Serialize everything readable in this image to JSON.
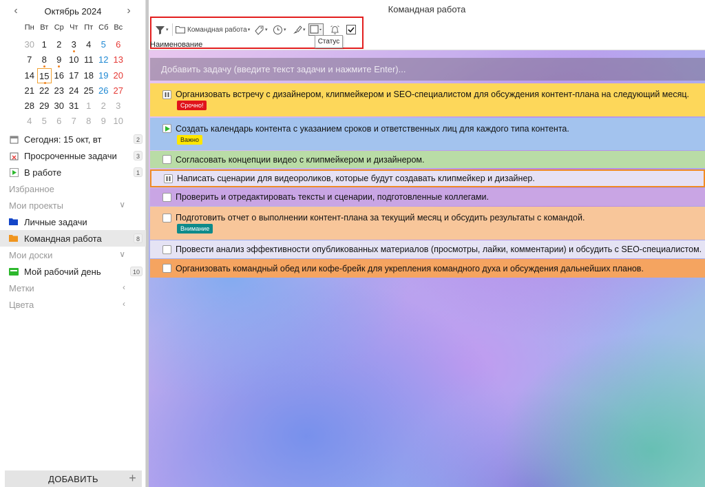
{
  "calendar": {
    "title": "Октябрь 2024",
    "prev": "‹",
    "next": "›",
    "weekdays": [
      "Пн",
      "Вт",
      "Ср",
      "Чт",
      "Пт",
      "Сб",
      "Вс"
    ],
    "weeks": [
      [
        "30",
        "1",
        "2",
        "3",
        "4",
        "5",
        "6"
      ],
      [
        "7",
        "8",
        "9",
        "10",
        "11",
        "12",
        "13"
      ],
      [
        "14",
        "15",
        "16",
        "17",
        "18",
        "19",
        "20"
      ],
      [
        "21",
        "22",
        "23",
        "24",
        "25",
        "26",
        "27"
      ],
      [
        "28",
        "29",
        "30",
        "31",
        "1",
        "2",
        "3"
      ],
      [
        "4",
        "5",
        "6",
        "7",
        "8",
        "9",
        "10"
      ]
    ],
    "today": "15"
  },
  "nav": {
    "today": {
      "label": "Сегодня: 15 окт, вт",
      "count": "2"
    },
    "overdue": {
      "label": "Просроченные задачи",
      "count": "3"
    },
    "in_progress": {
      "label": "В работе",
      "count": "1"
    },
    "favorites": "Избранное",
    "my_projects": "Мои проекты",
    "personal": "Личные задачи",
    "team": {
      "label": "Командная работа",
      "count": "8"
    },
    "my_boards": "Мои доски",
    "workday": {
      "label": "Мой рабочий день",
      "count": "10"
    },
    "tags": "Метки",
    "colors": "Цвета"
  },
  "add_button": "ДОБАВИТЬ",
  "add_plus": "+",
  "main": {
    "title": "Командная работа",
    "toolbar": {
      "project": "Командная работа",
      "tooltip": "Статус"
    },
    "column_header": "Наименование",
    "add_task_placeholder": "Добавить задачу (введите текст задачи и нажмите Enter)..."
  },
  "tasks": [
    {
      "text": "Организовать встречу с дизайнером, клипмейкером и SEO-специалистом для обсуждения контент-плана на следующий месяц.",
      "tag": "Срочно!",
      "status": "paused",
      "color": "#fdd75a",
      "tag_bg": "#e0141b",
      "tag_fg": "#ffffff"
    },
    {
      "text": "Создать календарь контента с указанием сроков и ответственных лиц для каждого типа контента.",
      "tag": "Важно",
      "status": "running",
      "color": "#a3c3ee",
      "tag_bg": "#ffe600",
      "tag_fg": "#222222"
    },
    {
      "text": "Согласовать концепции видео с клипмейкером и дизайнером.",
      "tag": "",
      "status": "todo",
      "color": "#b9dca6"
    },
    {
      "text": "Написать сценарии для видеороликов, которые будут создавать клипмейкер и дизайнер.",
      "tag": "",
      "status": "paused",
      "color": "#e6e1f4",
      "selected": true
    },
    {
      "text": "Проверить и отредактировать тексты и сценарии, подготовленные коллегами.",
      "tag": "",
      "status": "todo",
      "color": "#c9a5e4"
    },
    {
      "text": "Подготовить отчет о выполнении контент-плана за текущий месяц и обсудить результаты с командой.",
      "tag": "Внимание",
      "status": "todo",
      "color": "#f8c69a",
      "tag_bg": "#0e8a8a",
      "tag_fg": "#ffffff"
    },
    {
      "text": "Провести анализ эффективности опубликованных материалов (просмотры, лайки, комментарии) и обсудить с SEO-специалистом.",
      "tag": "",
      "status": "todo",
      "color": "#e5e3f4"
    },
    {
      "text": "Организовать командный обед или кофе-брейк для укрепления командного духа и обсуждения дальнейших планов.",
      "tag": "",
      "status": "todo",
      "color": "#f5a460"
    }
  ]
}
